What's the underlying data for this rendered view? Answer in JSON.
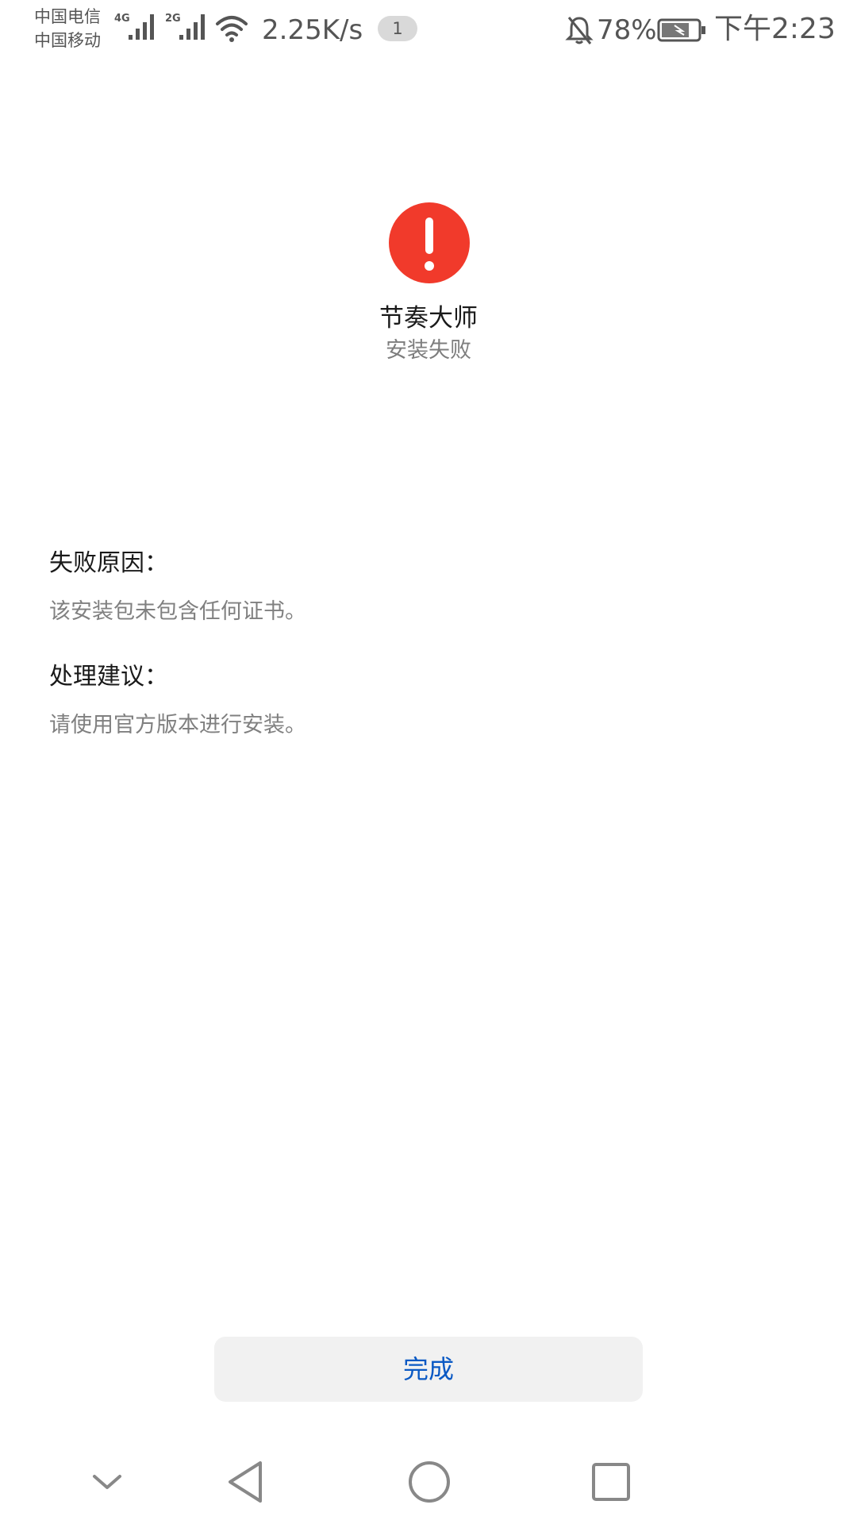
{
  "status_bar": {
    "carrier_1": "中国电信",
    "carrier_2": "中国移动",
    "sim1_network": "4G",
    "sim2_network": "2G",
    "net_speed": "2.25K/s",
    "notification_count": "1",
    "battery_percent": "78%",
    "time": "下午2:23",
    "icons": [
      "signal-icon",
      "wifi-icon",
      "bell-muted-icon",
      "battery-charging-icon"
    ]
  },
  "result": {
    "icon": "alert-icon",
    "icon_color": "#f13a2b",
    "app_name": "节奏大师",
    "status": "安装失败"
  },
  "details": {
    "reason_heading": "失败原因：",
    "reason_text": "该安装包未包含任何证书。",
    "advice_heading": "处理建议：",
    "advice_text": "请使用官方版本进行安装。"
  },
  "actions": {
    "done_label": "完成",
    "accent_color": "#0a59c4"
  },
  "nav_bar": {
    "keys": [
      "collapse-icon",
      "back-icon",
      "home-icon",
      "recents-icon"
    ]
  }
}
